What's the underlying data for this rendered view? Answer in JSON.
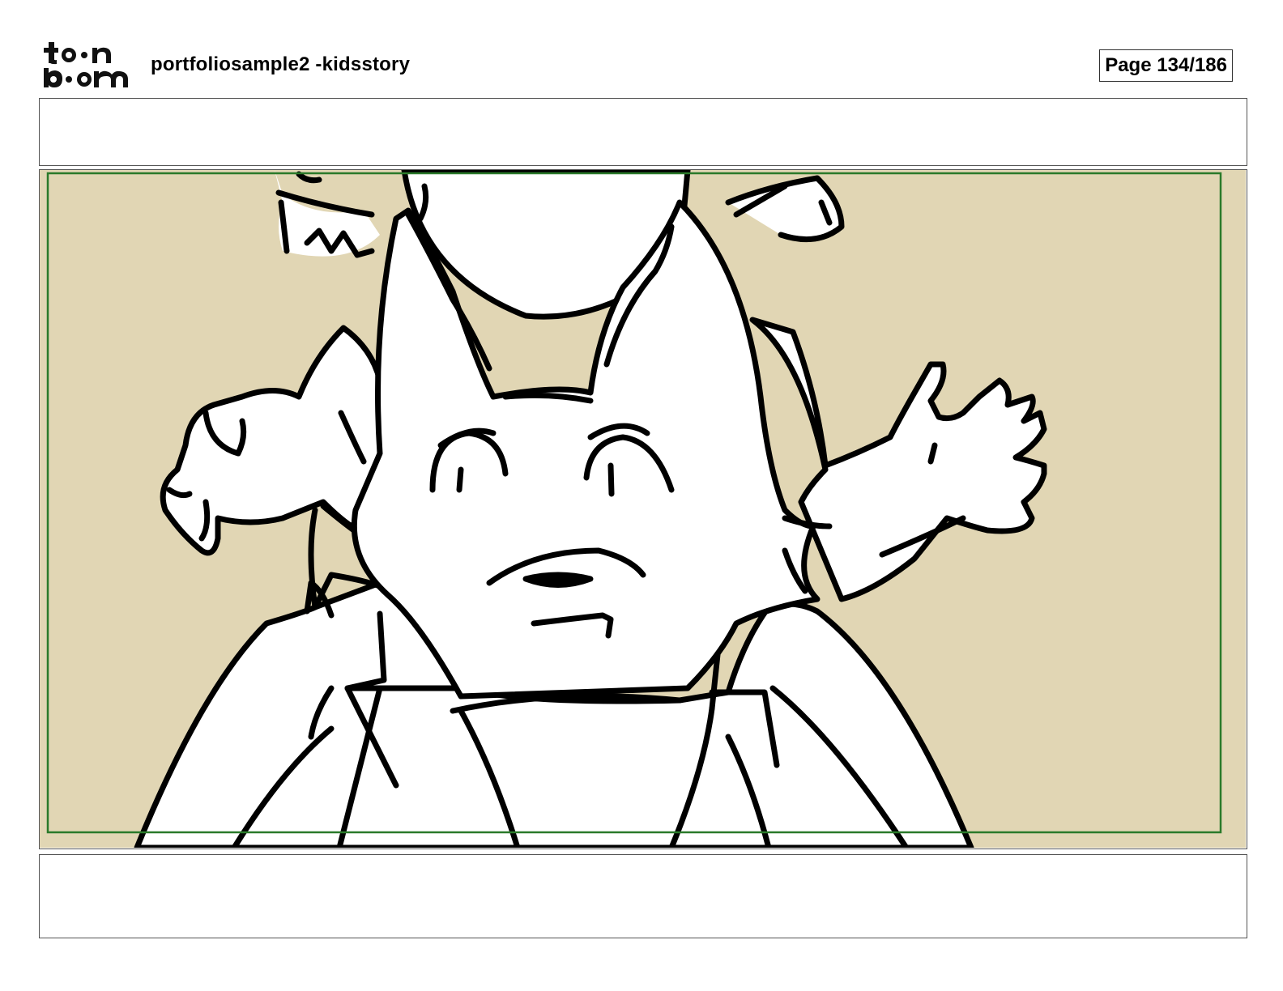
{
  "header": {
    "logo_text": "toon boom",
    "project_title": "portfoliosample2 -kidsstory",
    "page_counter": "Page 134/186"
  },
  "panel": {
    "action_notes": "",
    "dialogue_notes": "",
    "background_color": "#e1d6b4",
    "safe_frame_color": "#2a7a2a"
  }
}
